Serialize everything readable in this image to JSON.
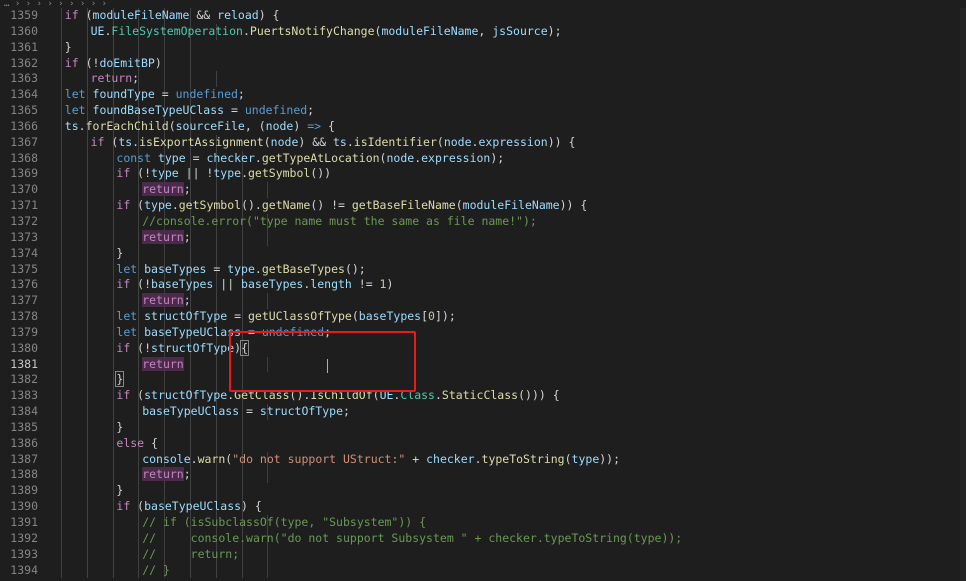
{
  "breadcrumb": "… ›   ›   ›   ›   ›   ›   ›   ›   ›  ",
  "lines": [
    {
      "n": "1359",
      "indent": 6,
      "toks": [
        [
          "ctl",
          "if"
        ],
        [
          "pun",
          " ("
        ],
        [
          "var",
          "moduleFileName"
        ],
        [
          "pun",
          " && "
        ],
        [
          "var",
          "reload"
        ],
        [
          "pun",
          ") {"
        ]
      ]
    },
    {
      "n": "1360",
      "indent": 7,
      "toks": [
        [
          "var",
          "UE"
        ],
        [
          "pun",
          "."
        ],
        [
          "cls",
          "FileSystemOperation"
        ],
        [
          "pun",
          "."
        ],
        [
          "fn",
          "PuertsNotifyChange"
        ],
        [
          "pun",
          "("
        ],
        [
          "var",
          "moduleFileName"
        ],
        [
          "pun",
          ", "
        ],
        [
          "var",
          "jsSource"
        ],
        [
          "pun",
          ");"
        ]
      ]
    },
    {
      "n": "1361",
      "indent": 6,
      "toks": [
        [
          "pun",
          "}"
        ]
      ]
    },
    {
      "n": "1362",
      "indent": 6,
      "toks": [
        [
          "ctl",
          "if"
        ],
        [
          "pun",
          " (!"
        ],
        [
          "var",
          "doEmitBP"
        ],
        [
          "pun",
          ")"
        ]
      ]
    },
    {
      "n": "1363",
      "indent": 7,
      "toks": [
        [
          "ctl",
          "return"
        ],
        [
          "pun",
          ";"
        ]
      ]
    },
    {
      "n": "1364",
      "indent": 6,
      "toks": [
        [
          "kw",
          "let"
        ],
        [
          "pun",
          " "
        ],
        [
          "var",
          "foundType"
        ],
        [
          "pun",
          " = "
        ],
        [
          "kw",
          "undefined"
        ],
        [
          "pun",
          ";"
        ]
      ]
    },
    {
      "n": "1365",
      "indent": 6,
      "toks": [
        [
          "kw",
          "let"
        ],
        [
          "pun",
          " "
        ],
        [
          "var",
          "foundBaseTypeUClass"
        ],
        [
          "pun",
          " = "
        ],
        [
          "kw",
          "undefined"
        ],
        [
          "pun",
          ";"
        ]
      ]
    },
    {
      "n": "1366",
      "indent": 6,
      "toks": [
        [
          "var",
          "ts"
        ],
        [
          "pun",
          "."
        ],
        [
          "fn",
          "forEachChild"
        ],
        [
          "pun",
          "("
        ],
        [
          "var",
          "sourceFile"
        ],
        [
          "pun",
          ", ("
        ],
        [
          "var",
          "node"
        ],
        [
          "pun",
          ") "
        ],
        [
          "kw",
          "=>"
        ],
        [
          "pun",
          " {"
        ]
      ]
    },
    {
      "n": "1367",
      "indent": 7,
      "toks": [
        [
          "ctl",
          "if"
        ],
        [
          "pun",
          " ("
        ],
        [
          "var",
          "ts"
        ],
        [
          "pun",
          "."
        ],
        [
          "fn",
          "isExportAssignment"
        ],
        [
          "pun",
          "("
        ],
        [
          "var",
          "node"
        ],
        [
          "pun",
          ") && "
        ],
        [
          "var",
          "ts"
        ],
        [
          "pun",
          "."
        ],
        [
          "fn",
          "isIdentifier"
        ],
        [
          "pun",
          "("
        ],
        [
          "var",
          "node"
        ],
        [
          "pun",
          "."
        ],
        [
          "var",
          "expression"
        ],
        [
          "pun",
          ")) {"
        ]
      ]
    },
    {
      "n": "1368",
      "indent": 8,
      "toks": [
        [
          "kw",
          "const"
        ],
        [
          "pun",
          " "
        ],
        [
          "var",
          "type"
        ],
        [
          "pun",
          " = "
        ],
        [
          "var",
          "checker"
        ],
        [
          "pun",
          "."
        ],
        [
          "fn",
          "getTypeAtLocation"
        ],
        [
          "pun",
          "("
        ],
        [
          "var",
          "node"
        ],
        [
          "pun",
          "."
        ],
        [
          "var",
          "expression"
        ],
        [
          "pun",
          ");"
        ]
      ]
    },
    {
      "n": "1369",
      "indent": 8,
      "toks": [
        [
          "ctl",
          "if"
        ],
        [
          "pun",
          " (!"
        ],
        [
          "var",
          "type"
        ],
        [
          "pun",
          " || !"
        ],
        [
          "var",
          "type"
        ],
        [
          "pun",
          "."
        ],
        [
          "fn",
          "getSymbol"
        ],
        [
          "pun",
          "())"
        ]
      ]
    },
    {
      "n": "1370",
      "indent": 9,
      "toks": [
        [
          "ret",
          "return"
        ],
        [
          "pun",
          ";"
        ]
      ]
    },
    {
      "n": "1371",
      "indent": 8,
      "toks": [
        [
          "ctl",
          "if"
        ],
        [
          "pun",
          " ("
        ],
        [
          "var",
          "type"
        ],
        [
          "pun",
          "."
        ],
        [
          "fn",
          "getSymbol"
        ],
        [
          "pun",
          "()."
        ],
        [
          "fn",
          "getName"
        ],
        [
          "pun",
          "() != "
        ],
        [
          "fn",
          "getBaseFileName"
        ],
        [
          "pun",
          "("
        ],
        [
          "var",
          "moduleFileName"
        ],
        [
          "pun",
          ")) {"
        ]
      ]
    },
    {
      "n": "1372",
      "indent": 9,
      "toks": [
        [
          "cmt",
          "//console.error(\"type name must the same as file name!\");"
        ]
      ]
    },
    {
      "n": "1373",
      "indent": 9,
      "toks": [
        [
          "ret",
          "return"
        ],
        [
          "pun",
          ";"
        ]
      ]
    },
    {
      "n": "1374",
      "indent": 8,
      "toks": [
        [
          "pun",
          "}"
        ]
      ]
    },
    {
      "n": "1375",
      "indent": 8,
      "toks": [
        [
          "kw",
          "let"
        ],
        [
          "pun",
          " "
        ],
        [
          "var",
          "baseTypes"
        ],
        [
          "pun",
          " = "
        ],
        [
          "var",
          "type"
        ],
        [
          "pun",
          "."
        ],
        [
          "fn",
          "getBaseTypes"
        ],
        [
          "pun",
          "();"
        ]
      ]
    },
    {
      "n": "1376",
      "indent": 8,
      "toks": [
        [
          "ctl",
          "if"
        ],
        [
          "pun",
          " (!"
        ],
        [
          "var",
          "baseTypes"
        ],
        [
          "pun",
          " || "
        ],
        [
          "var",
          "baseTypes"
        ],
        [
          "pun",
          "."
        ],
        [
          "var",
          "length"
        ],
        [
          "pun",
          " != "
        ],
        [
          "num",
          "1"
        ],
        [
          "pun",
          ")"
        ]
      ]
    },
    {
      "n": "1377",
      "indent": 9,
      "toks": [
        [
          "ret",
          "return"
        ],
        [
          "pun",
          ";"
        ]
      ]
    },
    {
      "n": "1378",
      "indent": 8,
      "toks": [
        [
          "kw",
          "let"
        ],
        [
          "pun",
          " "
        ],
        [
          "var",
          "structOfType"
        ],
        [
          "pun",
          " = "
        ],
        [
          "fn",
          "getUClassOfType"
        ],
        [
          "pun",
          "("
        ],
        [
          "var",
          "baseTypes"
        ],
        [
          "pun",
          "["
        ],
        [
          "num",
          "0"
        ],
        [
          "pun",
          "]);"
        ]
      ]
    },
    {
      "n": "1379",
      "indent": 8,
      "toks": [
        [
          "kw",
          "let"
        ],
        [
          "pun",
          " "
        ],
        [
          "var",
          "baseTypeUClass"
        ],
        [
          "pun",
          " = "
        ],
        [
          "kw",
          "undefined"
        ],
        [
          "pun",
          ";"
        ]
      ]
    },
    {
      "n": "1380",
      "indent": 8,
      "toks": [
        [
          "ctl",
          "if"
        ],
        [
          "pun",
          " (!"
        ],
        [
          "var",
          "structOfType"
        ],
        [
          "pun",
          ")"
        ],
        [
          "bm",
          "{"
        ]
      ]
    },
    {
      "n": "1381",
      "indent": 9,
      "active": true,
      "toks": [
        [
          "ret",
          "return"
        ]
      ]
    },
    {
      "n": "1382",
      "indent": 8,
      "toks": [
        [
          "bm",
          "}"
        ]
      ]
    },
    {
      "n": "1383",
      "indent": 8,
      "toks": [
        [
          "ctl",
          "if"
        ],
        [
          "pun",
          " ("
        ],
        [
          "var",
          "structOfType"
        ],
        [
          "pun",
          "."
        ],
        [
          "fn",
          "GetClass"
        ],
        [
          "pun",
          "()."
        ],
        [
          "fn",
          "IsChildOf"
        ],
        [
          "pun",
          "("
        ],
        [
          "var",
          "UE"
        ],
        [
          "pun",
          "."
        ],
        [
          "cls",
          "Class"
        ],
        [
          "pun",
          "."
        ],
        [
          "fn",
          "StaticClass"
        ],
        [
          "pun",
          "())) {"
        ]
      ]
    },
    {
      "n": "1384",
      "indent": 9,
      "toks": [
        [
          "var",
          "baseTypeUClass"
        ],
        [
          "pun",
          " = "
        ],
        [
          "var",
          "structOfType"
        ],
        [
          "pun",
          ";"
        ]
      ]
    },
    {
      "n": "1385",
      "indent": 8,
      "toks": [
        [
          "pun",
          "}"
        ]
      ]
    },
    {
      "n": "1386",
      "indent": 8,
      "toks": [
        [
          "ctl",
          "else"
        ],
        [
          "pun",
          " {"
        ]
      ]
    },
    {
      "n": "1387",
      "indent": 9,
      "toks": [
        [
          "var",
          "console"
        ],
        [
          "pun",
          "."
        ],
        [
          "fn",
          "warn"
        ],
        [
          "pun",
          "("
        ],
        [
          "str",
          "\"do not support UStruct:\""
        ],
        [
          "pun",
          " + "
        ],
        [
          "var",
          "checker"
        ],
        [
          "pun",
          "."
        ],
        [
          "fn",
          "typeToString"
        ],
        [
          "pun",
          "("
        ],
        [
          "var",
          "type"
        ],
        [
          "pun",
          "));"
        ]
      ]
    },
    {
      "n": "1388",
      "indent": 9,
      "toks": [
        [
          "ret",
          "return"
        ],
        [
          "pun",
          ";"
        ]
      ]
    },
    {
      "n": "1389",
      "indent": 8,
      "toks": [
        [
          "pun",
          "}"
        ]
      ]
    },
    {
      "n": "1390",
      "indent": 8,
      "toks": [
        [
          "ctl",
          "if"
        ],
        [
          "pun",
          " ("
        ],
        [
          "var",
          "baseTypeUClass"
        ],
        [
          "pun",
          ") {"
        ]
      ]
    },
    {
      "n": "1391",
      "indent": 9,
      "toks": [
        [
          "cmt",
          "// if (isSubclassOf(type, \"Subsystem\")) {"
        ]
      ]
    },
    {
      "n": "1392",
      "indent": 9,
      "toks": [
        [
          "cmt",
          "//     console.warn(\"do not support Subsystem \" + checker.typeToString(type));"
        ]
      ]
    },
    {
      "n": "1393",
      "indent": 9,
      "toks": [
        [
          "cmt",
          "//     return;"
        ]
      ]
    },
    {
      "n": "1394",
      "indent": 9,
      "toks": [
        [
          "cmt",
          "// }"
        ]
      ]
    }
  ]
}
